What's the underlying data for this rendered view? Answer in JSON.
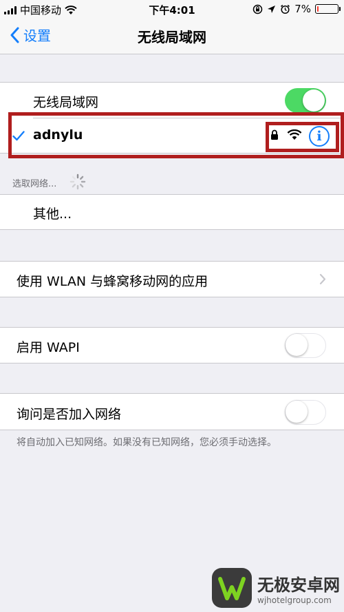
{
  "status_bar": {
    "carrier": "中国移动",
    "time": "下午4:01",
    "battery": "7%",
    "battery_level": 0.07
  },
  "nav": {
    "back_label": "设置",
    "title": "无线局域网"
  },
  "wifi_toggle": {
    "label": "无线局域网",
    "on": true
  },
  "connected_network": {
    "name": "adnylu",
    "secured": true,
    "info_glyph": "i"
  },
  "choose_network_label": "选取网络...",
  "other_label": "其他...",
  "wlan_apps_label": "使用 WLAN 与蜂窝移动网的应用",
  "wapi": {
    "label": "启用 WAPI",
    "on": false
  },
  "ask_join": {
    "label": "询问是否加入网络",
    "on": false,
    "note": "将自动加入已知网络。如果没有已知网络，您必须手动选择。"
  },
  "watermark": {
    "title": "无极安卓网",
    "url": "wjhotelgroup.com"
  },
  "colors": {
    "accent": "#147efb",
    "toggle_on": "#4cd964",
    "highlight": "#b01e1e",
    "background": "#efeff4"
  }
}
